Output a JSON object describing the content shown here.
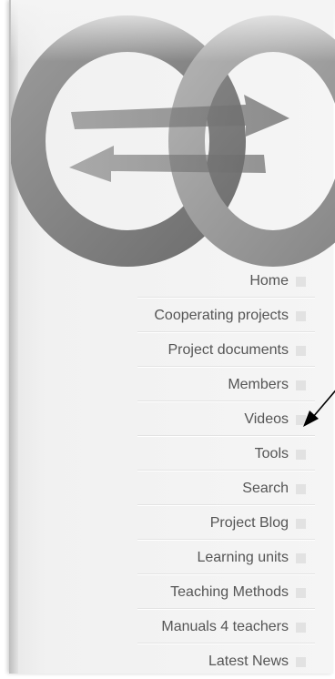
{
  "nav": {
    "items": [
      {
        "label": "Home"
      },
      {
        "label": "Cooperating projects"
      },
      {
        "label": "Project documents"
      },
      {
        "label": "Members"
      },
      {
        "label": "Videos"
      },
      {
        "label": "Tools"
      },
      {
        "label": "Search"
      },
      {
        "label": "Project Blog"
      },
      {
        "label": "Learning units"
      },
      {
        "label": "Teaching Methods"
      },
      {
        "label": "Manuals 4 teachers"
      },
      {
        "label": "Latest News"
      }
    ]
  },
  "logo": {
    "name": "double-ring-logo-with-arrows"
  },
  "annotation": {
    "icon": "pointer-arrow-icon",
    "target": "Videos"
  }
}
